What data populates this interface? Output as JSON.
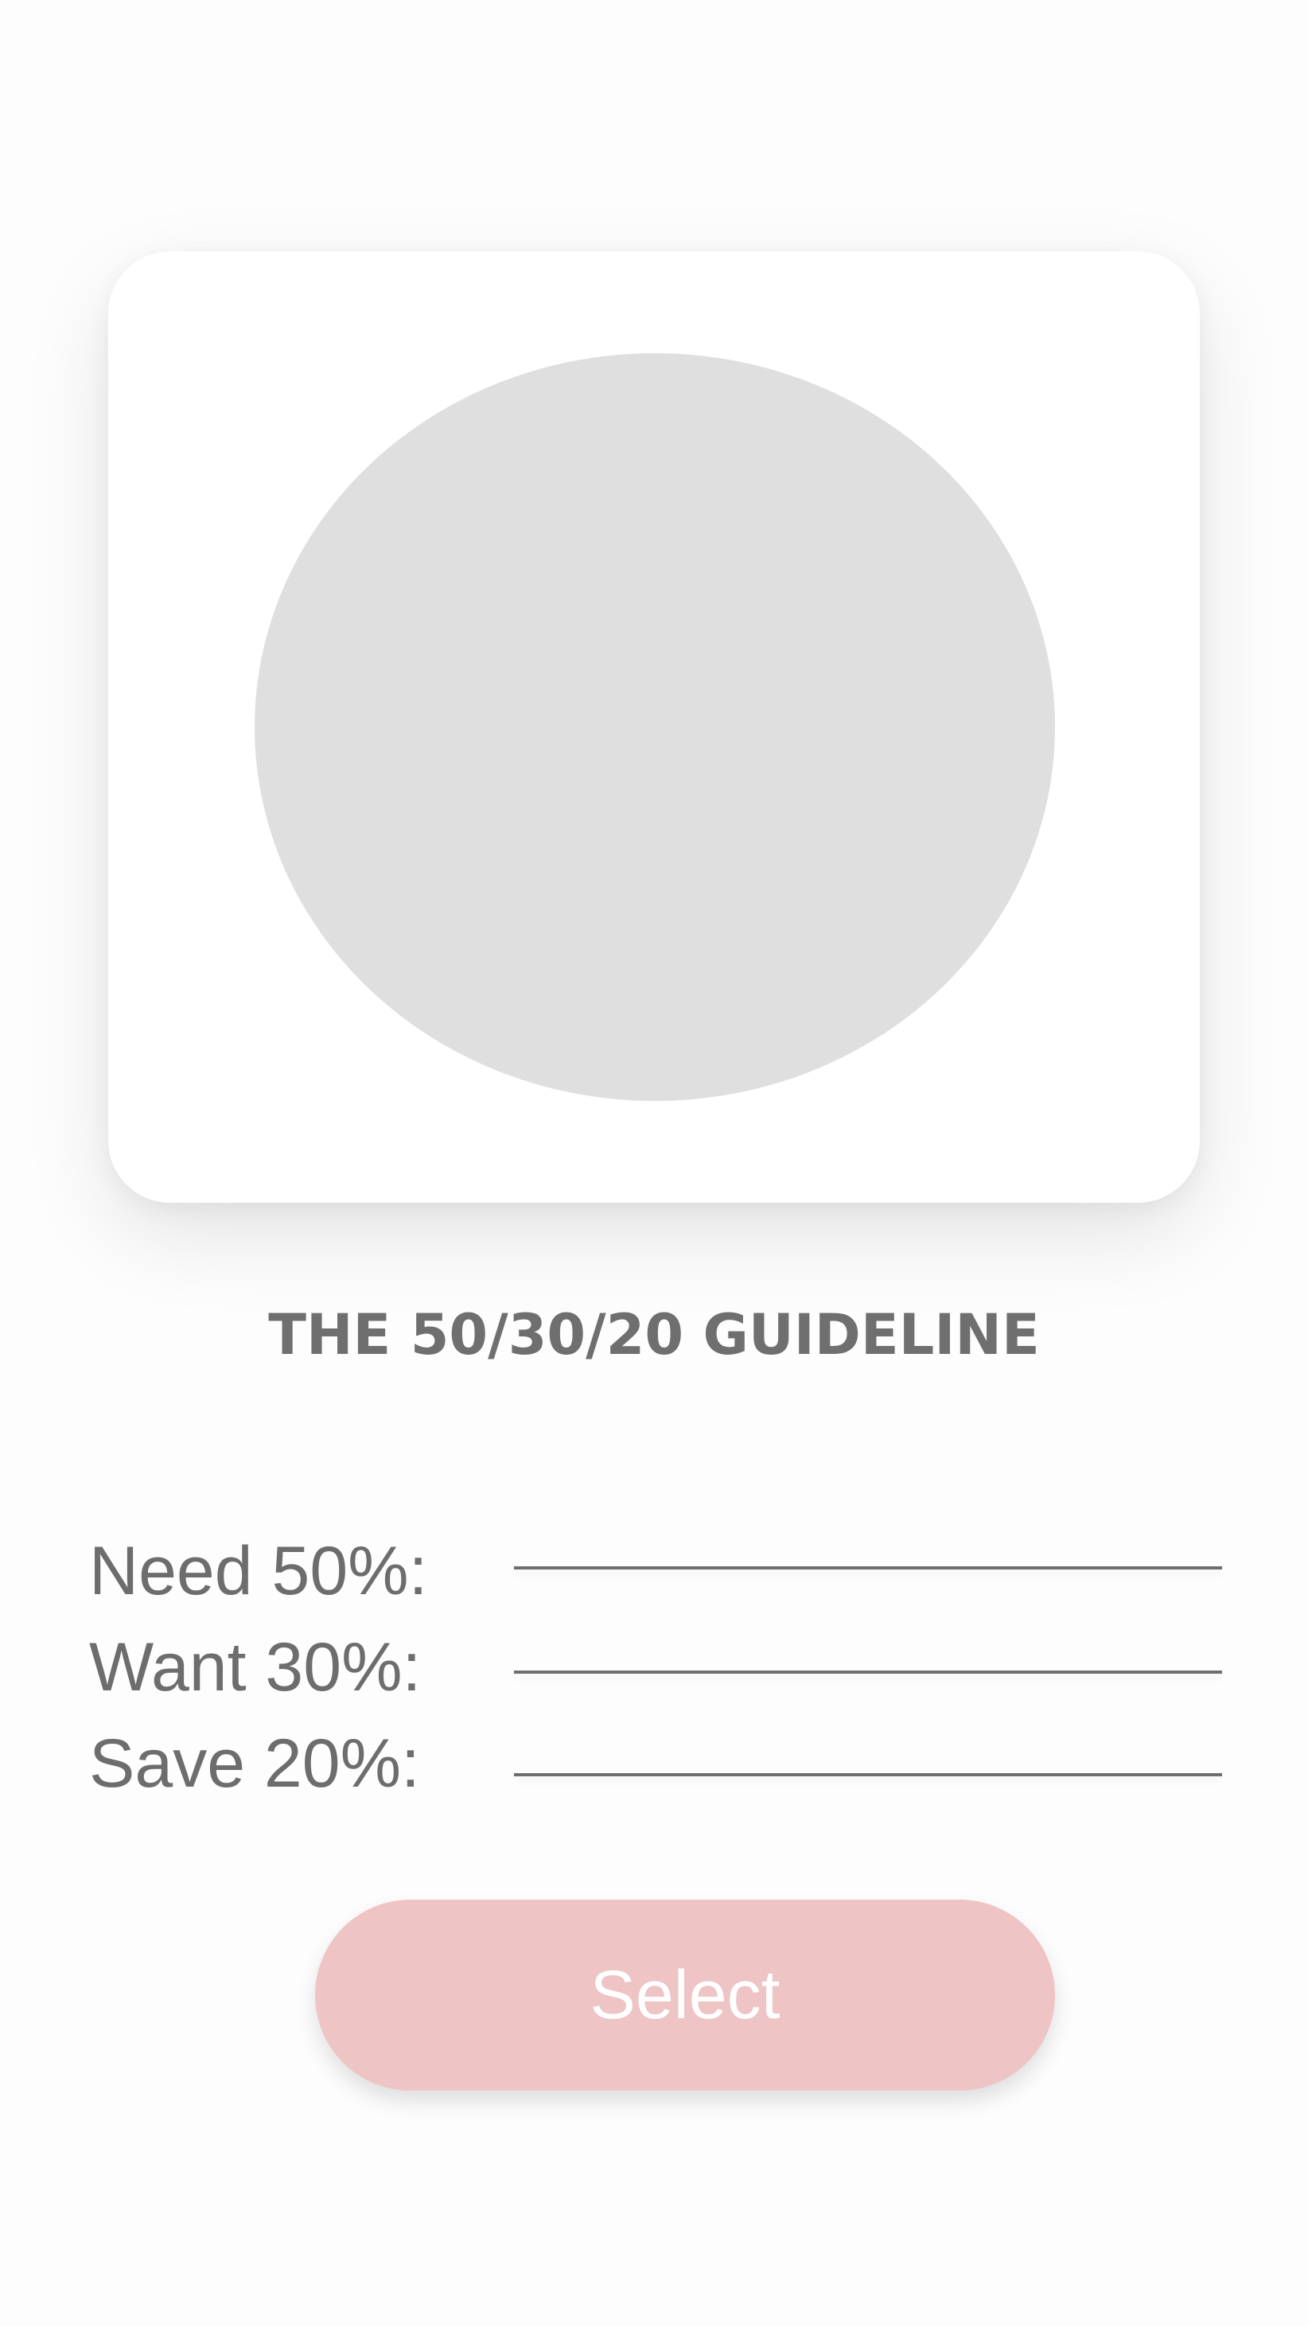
{
  "card": {
    "image_placeholder": "image-placeholder"
  },
  "title": "THE 50/30/20 GUIDELINE",
  "allocations": [
    {
      "label": "Need 50%:",
      "value": ""
    },
    {
      "label": "Want 30%:",
      "value": ""
    },
    {
      "label": "Save 20%:",
      "value": ""
    }
  ],
  "button": {
    "label": "Select"
  },
  "colors": {
    "background": "#fdfdfd",
    "card": "#ffffff",
    "placeholder": "#dfdfdf",
    "text": "#6f6f6f",
    "button": "#eec4c5",
    "button_text": "#ffffff"
  }
}
